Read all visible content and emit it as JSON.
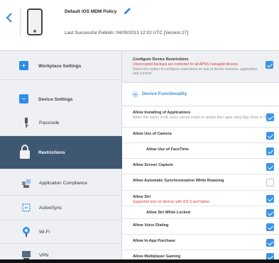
{
  "header": {
    "back_icon": "chevron-left-icon",
    "device_icon": "phone-icon",
    "policy_title": "Default iOS MDM Policy",
    "edit_icon": "pencil-icon",
    "last_publish": "Last Successful Publish: 04/09/2013 12:02 UTC  [Version:27]"
  },
  "sidebar": {
    "items": [
      {
        "label": "Workplace Settings",
        "icon": "plus-square-icon"
      },
      {
        "label": "Device Settings",
        "icon": "minus-square-icon"
      },
      {
        "label": "Passcode",
        "icon": "key-icon"
      },
      {
        "label": "Restrictions",
        "icon": "lock-icon",
        "active": true
      },
      {
        "label": "Application Compliance",
        "icon": "apps-icon"
      },
      {
        "label": "ActiveSync",
        "icon": "sync-icon"
      },
      {
        "label": "Wi-Fi",
        "icon": "wifi-icon"
      },
      {
        "label": "VPN",
        "icon": "vpn-icon"
      }
    ]
  },
  "main": {
    "configure": {
      "title": "Configure Device Restrictions",
      "warning": "Unencrypted backups are restricted for all APNS managed devices.",
      "description": "Select this option to configure restrictions on use of device features, application and content.",
      "checked": true
    },
    "section_title": "Device Functionality",
    "rows": [
      {
        "label": "Allow Installing of Applications",
        "sub": "When this option is off, users cannot install or update their apps using App Store or iTunes.",
        "checked": true
      },
      {
        "label": "Allow Use of Camera",
        "checked": true
      },
      {
        "label": "Allow Use of FaceTime",
        "checked": true
      },
      {
        "label": "Allow Screen Capture",
        "checked": true
      },
      {
        "label": "Allow Automatic Synchronization While Roaming",
        "checked": false
      },
      {
        "label": "Allow Siri",
        "sub": "Supported only on devices with iOS 5 and higher.",
        "checked": true
      },
      {
        "label": "Allow Siri While Locked",
        "checked": true
      },
      {
        "label": "Allow Voice Dialing",
        "checked": true
      },
      {
        "label": "Allow In-App Purchase",
        "checked": true
      },
      {
        "label": "Allow Multiplayer Gaming",
        "checked": true
      }
    ]
  },
  "colors": {
    "accent": "#3b94e6",
    "active_sidebar": "#3f5871",
    "warning": "#d8393c"
  }
}
